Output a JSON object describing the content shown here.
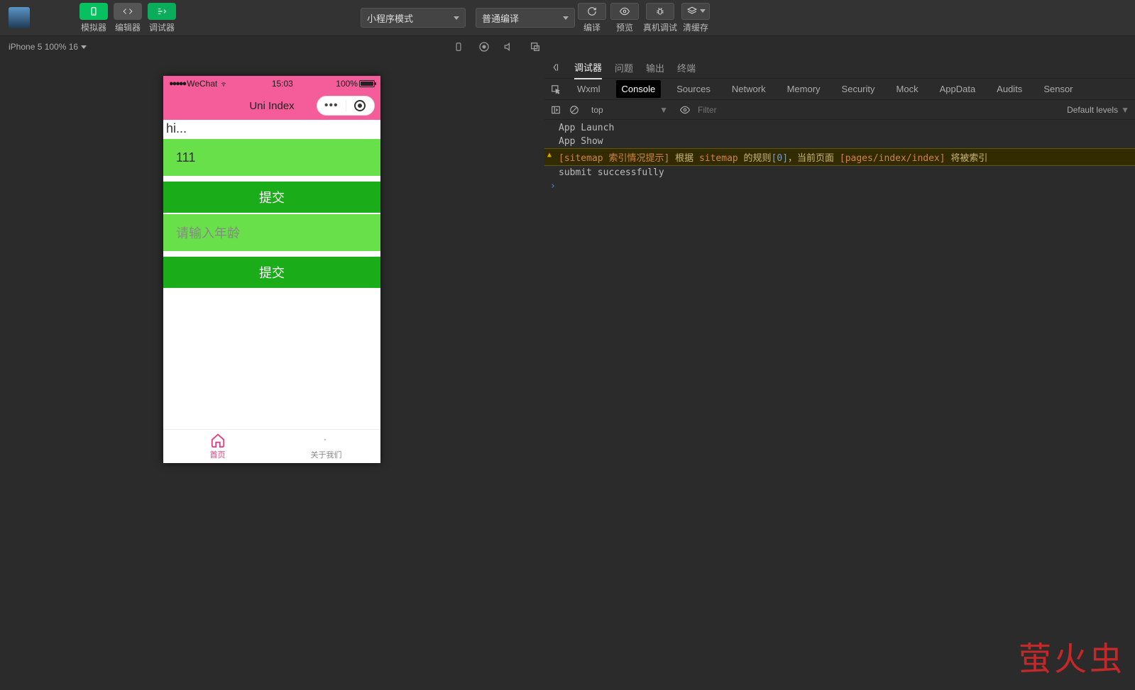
{
  "topbar": {
    "view_tabs": [
      "模拟器",
      "编辑器",
      "调试器"
    ],
    "mode_select": "小程序模式",
    "compile_select": "普通编译",
    "right_buttons": [
      "编译",
      "预览",
      "真机调试",
      "清缓存"
    ]
  },
  "device_label": "iPhone 5 100% 16",
  "simulator": {
    "carrier": "WeChat",
    "time": "15:03",
    "battery_pct": "100%",
    "page_title": "Uni Index",
    "hi_text": "hi...",
    "input1_value": "111",
    "submit1_label": "提交",
    "input2_placeholder": "请输入年龄",
    "submit2_label": "提交",
    "tabbar": {
      "home": "首页",
      "about": "关于我们"
    }
  },
  "right_pane": {
    "upper_tabs": [
      "调试器",
      "问题",
      "输出",
      "终端"
    ],
    "devtools_tabs": [
      "Wxml",
      "Console",
      "Sources",
      "Network",
      "Memory",
      "Security",
      "Mock",
      "AppData",
      "Audits",
      "Sensor"
    ],
    "console": {
      "context": "top",
      "filter_placeholder": "Filter",
      "levels": "Default levels",
      "logs": {
        "l1": "App Launch",
        "l2": "App Show",
        "warn_prefix": "[sitemap 索引情况提示]",
        "warn_mid1": " 根据 ",
        "warn_sitemap": "sitemap",
        "warn_mid2": " 的规则",
        "warn_idx": "[0]",
        "warn_mid3": "，当前页面 ",
        "warn_page": "[pages/index/index]",
        "warn_suffix": " 将被索引",
        "l4": "submit successfully"
      }
    }
  },
  "watermark": "萤火虫"
}
